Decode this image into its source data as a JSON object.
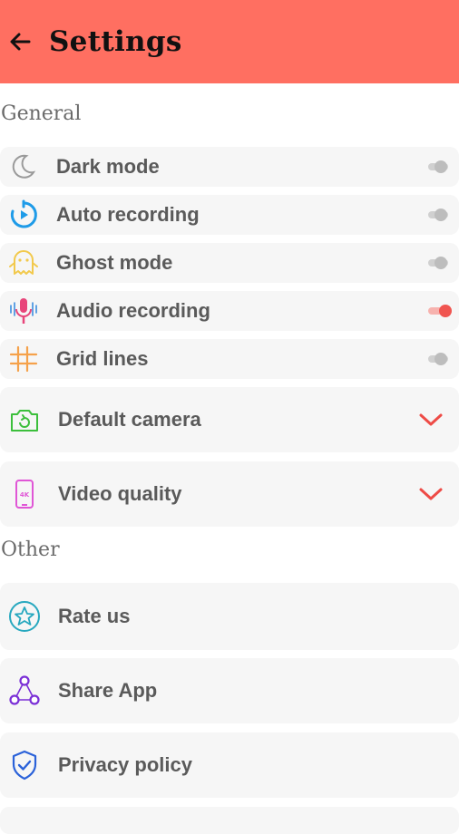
{
  "header": {
    "title": "Settings",
    "color": "#ff6f61"
  },
  "sections": {
    "general": "General",
    "other": "Other"
  },
  "toggles": [
    {
      "label": "Dark mode",
      "on": false,
      "icon": "moon-icon"
    },
    {
      "label": "Auto recording",
      "on": false,
      "icon": "timer-icon"
    },
    {
      "label": "Ghost mode",
      "on": false,
      "icon": "ghost-icon"
    },
    {
      "label": "Audio recording",
      "on": true,
      "icon": "microphone-icon"
    },
    {
      "label": "Grid lines",
      "on": false,
      "icon": "grid-icon"
    }
  ],
  "dropdowns": [
    {
      "label": "Default camera",
      "icon": "camera-switch-icon"
    },
    {
      "label": "Video quality",
      "icon": "phone-4k-icon"
    }
  ],
  "other": [
    {
      "label": "Rate us",
      "icon": "star-circle-icon"
    },
    {
      "label": "Share App",
      "icon": "share-icon"
    },
    {
      "label": "Privacy policy",
      "icon": "shield-check-icon"
    }
  ],
  "colors": {
    "accent": "#f05550",
    "row_bg": "#f6f6f6"
  }
}
